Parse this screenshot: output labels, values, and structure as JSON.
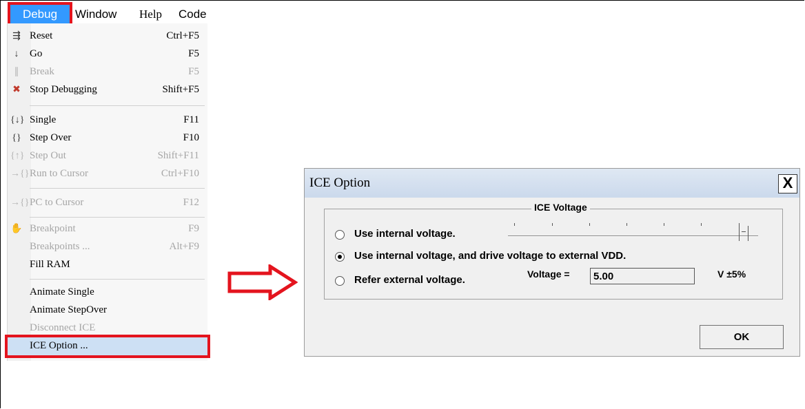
{
  "menubar": {
    "items": [
      "Debug",
      "Window",
      "Help",
      "Code"
    ]
  },
  "menu": {
    "items": [
      {
        "label": "Reset",
        "shortcut": "Ctrl+F5",
        "icon": "reset-icon",
        "disabled": false
      },
      {
        "label": "Go",
        "shortcut": "F5",
        "icon": "go-icon",
        "disabled": false
      },
      {
        "label": "Break",
        "shortcut": "F5",
        "icon": "break-icon",
        "disabled": true
      },
      {
        "label": "Stop Debugging",
        "shortcut": "Shift+F5",
        "icon": "stop-debugging-icon",
        "disabled": false
      },
      {
        "label": "Single",
        "shortcut": "F11",
        "icon": "step-into-icon",
        "disabled": false
      },
      {
        "label": "Step Over",
        "shortcut": "F10",
        "icon": "step-over-icon",
        "disabled": false
      },
      {
        "label": "Step Out",
        "shortcut": "Shift+F11",
        "icon": "step-out-icon",
        "disabled": true
      },
      {
        "label": "Run to Cursor",
        "shortcut": "Ctrl+F10",
        "icon": "run-to-cursor-icon",
        "disabled": true
      },
      {
        "label": "PC to Cursor",
        "shortcut": "F12",
        "icon": "pc-to-cursor-icon",
        "disabled": true
      },
      {
        "label": "Breakpoint",
        "shortcut": "F9",
        "icon": "hand-icon",
        "disabled": true
      },
      {
        "label": "Breakpoints ...",
        "shortcut": "Alt+F9",
        "icon": "",
        "disabled": true
      },
      {
        "label": "Fill RAM",
        "shortcut": "",
        "icon": "",
        "disabled": false
      },
      {
        "label": "Animate Single",
        "shortcut": "",
        "icon": "",
        "disabled": false
      },
      {
        "label": "Animate StepOver",
        "shortcut": "",
        "icon": "",
        "disabled": false
      },
      {
        "label": "Disconnect ICE",
        "shortcut": "",
        "icon": "",
        "disabled": true
      },
      {
        "label": "ICE Option ...",
        "shortcut": "",
        "icon": "",
        "disabled": false
      }
    ]
  },
  "dialog": {
    "title": "ICE Option",
    "close": "X",
    "group_title": "ICE Voltage",
    "options": [
      {
        "label": "Use internal voltage.",
        "selected": false
      },
      {
        "label": "Use internal voltage, and drive voltage to external VDD.",
        "selected": true
      },
      {
        "label": "Refer external voltage.",
        "selected": false
      }
    ],
    "voltage_label": "Voltage =",
    "voltage_value": "5.00",
    "voltage_unit": "V ±5%",
    "ok": "OK"
  },
  "colors": {
    "highlight_border": "#e4141e",
    "menu_selected": "#3399ff"
  }
}
